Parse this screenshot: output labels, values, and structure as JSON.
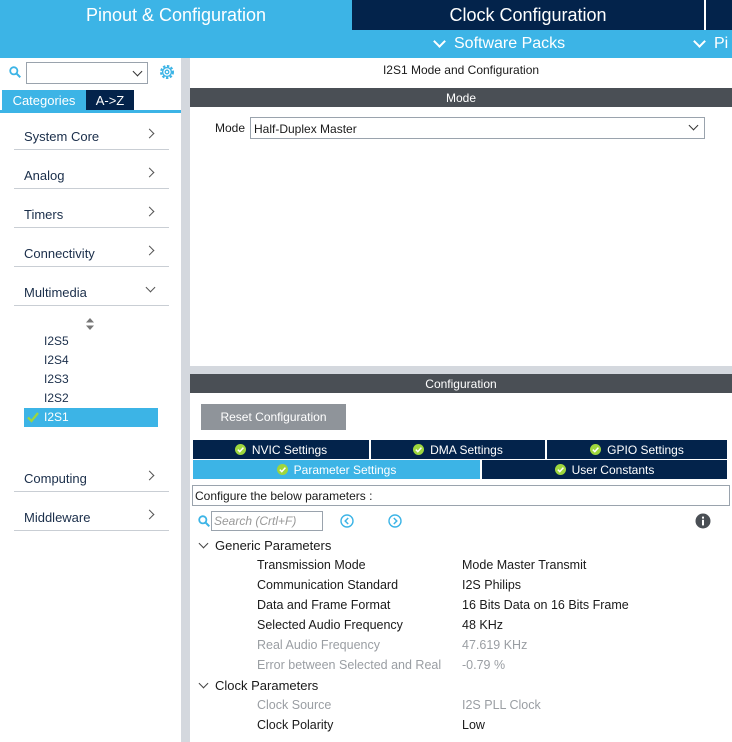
{
  "top_tabs": {
    "pinout": "Pinout & Configuration",
    "clock": "Clock Configuration",
    "software_packs": "Software Packs",
    "pinout_menu": "Pi"
  },
  "left": {
    "category_tab": "Categories",
    "az_tab": "A->Z",
    "categories": [
      {
        "label": "System Core"
      },
      {
        "label": "Analog"
      },
      {
        "label": "Timers"
      },
      {
        "label": "Connectivity"
      },
      {
        "label": "Multimedia"
      },
      {
        "label": "Computing"
      },
      {
        "label": "Middleware"
      }
    ],
    "multimedia_items": [
      "I2S5",
      "I2S4",
      "I2S3",
      "I2S2",
      "I2S1"
    ],
    "selected_item": "I2S1"
  },
  "mode": {
    "title": "I2S1 Mode and Configuration",
    "header": "Mode",
    "label": "Mode",
    "value": "Half-Duplex Master"
  },
  "configuration": {
    "header": "Configuration",
    "reset_button": "Reset Configuration",
    "tabs": {
      "nvic": "NVIC Settings",
      "dma": "DMA Settings",
      "gpio": "GPIO Settings",
      "parameter": "Parameter Settings",
      "user_constants": "User Constants"
    },
    "configure_text": "Configure the below parameters :",
    "search_placeholder": "Search (Crtl+F)",
    "groups": {
      "generic": "Generic Parameters",
      "clock": "Clock Parameters"
    },
    "generic_params": [
      {
        "name": "Transmission Mode",
        "value": "Mode Master Transmit"
      },
      {
        "name": "Communication Standard",
        "value": "I2S Philips"
      },
      {
        "name": "Data and Frame Format",
        "value": "16 Bits Data on 16 Bits Frame"
      },
      {
        "name": "Selected Audio Frequency",
        "value": "48 KHz"
      },
      {
        "name": "Real Audio Frequency",
        "value": "47.619 KHz"
      },
      {
        "name": "Error between Selected and Real",
        "value": "-0.79 %"
      }
    ],
    "clock_params": [
      {
        "name": "Clock Source",
        "value": "I2S PLL Clock"
      },
      {
        "name": "Clock Polarity",
        "value": "Low"
      }
    ]
  },
  "colors": {
    "accent": "#3cb4e6",
    "navy": "#03234b",
    "header_gray": "#4a4f55",
    "ok_green": "#9ed63d"
  }
}
